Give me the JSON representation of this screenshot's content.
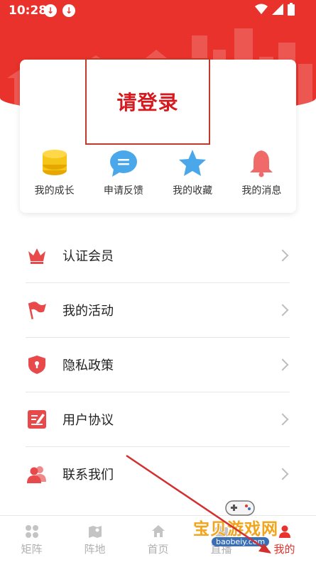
{
  "status_bar": {
    "time": "10:28"
  },
  "login": {
    "label": "请登录"
  },
  "quick_actions": [
    {
      "label": "我的成长",
      "icon": "coin-stack-icon"
    },
    {
      "label": "申请反馈",
      "icon": "chat-bubble-icon"
    },
    {
      "label": "我的收藏",
      "icon": "star-icon"
    },
    {
      "label": "我的消息",
      "icon": "bell-icon"
    }
  ],
  "menu": [
    {
      "label": "认证会员",
      "icon": "crown-icon"
    },
    {
      "label": "我的活动",
      "icon": "flag-icon"
    },
    {
      "label": "隐私政策",
      "icon": "shield-icon"
    },
    {
      "label": "用户协议",
      "icon": "edit-document-icon"
    },
    {
      "label": "联系我们",
      "icon": "contacts-icon"
    }
  ],
  "tabbar": [
    {
      "label": "矩阵",
      "icon": "grid-icon"
    },
    {
      "label": "阵地",
      "icon": "map-icon"
    },
    {
      "label": "首页",
      "icon": "home-icon"
    },
    {
      "label": "直播",
      "icon": "tv-icon"
    },
    {
      "label": "我的",
      "icon": "person-icon",
      "active": true
    }
  ],
  "watermark": {
    "title": "宝贝游戏网",
    "url": "baobeiy.com"
  },
  "colors": {
    "primary": "#e8322b",
    "icon_red": "#e8494a",
    "gold": "#f5c518",
    "blue": "#4aa8ea"
  }
}
